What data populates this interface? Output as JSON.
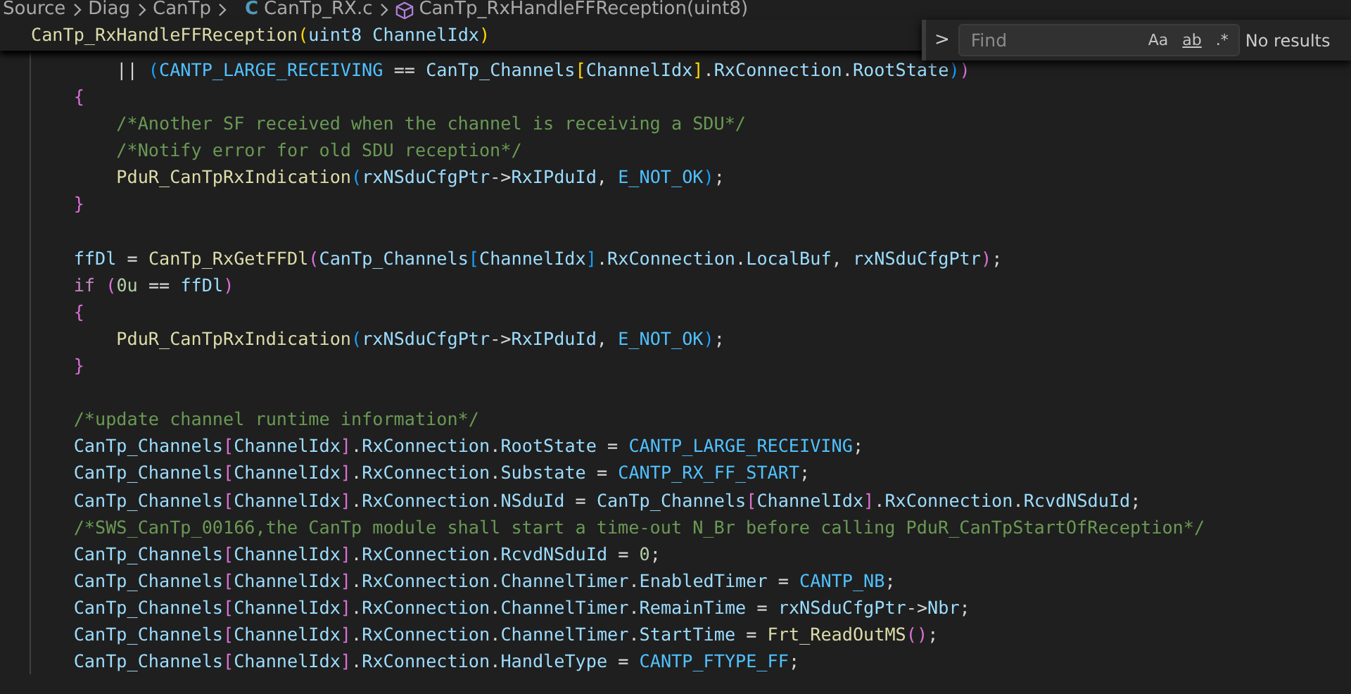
{
  "breadcrumb": {
    "items": [
      {
        "kind": "folder",
        "label": "Source"
      },
      {
        "kind": "folder",
        "label": "Diag"
      },
      {
        "kind": "folder",
        "label": "CanTp"
      },
      {
        "kind": "file",
        "icon": "C",
        "label": "CanTp_RX.c"
      },
      {
        "kind": "symbol",
        "label": "CanTp_RxHandleFFReception(uint8)"
      }
    ]
  },
  "sticky_header": "CanTp_RxHandleFFReception(uint8 ChannelIdx)",
  "find_widget": {
    "expand_glyph": ">",
    "placeholder": "Find",
    "options": [
      {
        "label": "Aa",
        "on": false
      },
      {
        "label": "ab",
        "on": false
      },
      {
        "label": ".*",
        "on": false
      }
    ],
    "status": "No results"
  },
  "blocks": [
    [
      "        || (CANTP_LARGE_RECEIVING == CanTp_Channels[ChannelIdx].RxConnection.RootState))",
      "    {",
      "        /*Another SF received when the channel is receiving a SDU*/",
      "        /*Notify error for old SDU reception*/",
      "        PduR_CanTpRxIndication(rxNSduCfgPtr->RxIPduId, E_NOT_OK);",
      "    }"
    ],
    [
      "    ffDl = CanTp_RxGetFFDl(CanTp_Channels[ChannelIdx].RxConnection.LocalBuf, rxNSduCfgPtr);",
      "    if (0u == ffDl)",
      "    {",
      "        PduR_CanTpRxIndication(rxNSduCfgPtr->RxIPduId, E_NOT_OK);",
      "    }"
    ],
    [
      "    /*update channel runtime information*/",
      "    CanTp_Channels[ChannelIdx].RxConnection.RootState = CANTP_LARGE_RECEIVING;",
      "    CanTp_Channels[ChannelIdx].RxConnection.Substate = CANTP_RX_FF_START;",
      "    CanTp_Channels[ChannelIdx].RxConnection.NSduId = CanTp_Channels[ChannelIdx].RxConnection.RcvdNSduId;",
      "    /*SWS_CanTp_00166,the CanTp module shall start a time-out N_Br before calling PduR_CanTpStartOfReception*/",
      "    CanTp_Channels[ChannelIdx].RxConnection.RcvdNSduId = 0;",
      "    CanTp_Channels[ChannelIdx].RxConnection.ChannelTimer.EnabledTimer = CANTP_NB;",
      "    CanTp_Channels[ChannelIdx].RxConnection.ChannelTimer.RemainTime = rxNSduCfgPtr->Nbr;",
      "    CanTp_Channels[ChannelIdx].RxConnection.ChannelTimer.StartTime = Frt_ReadOutMS();",
      "    CanTp_Channels[ChannelIdx].RxConnection.HandleType = CANTP_FTYPE_FF;"
    ]
  ]
}
